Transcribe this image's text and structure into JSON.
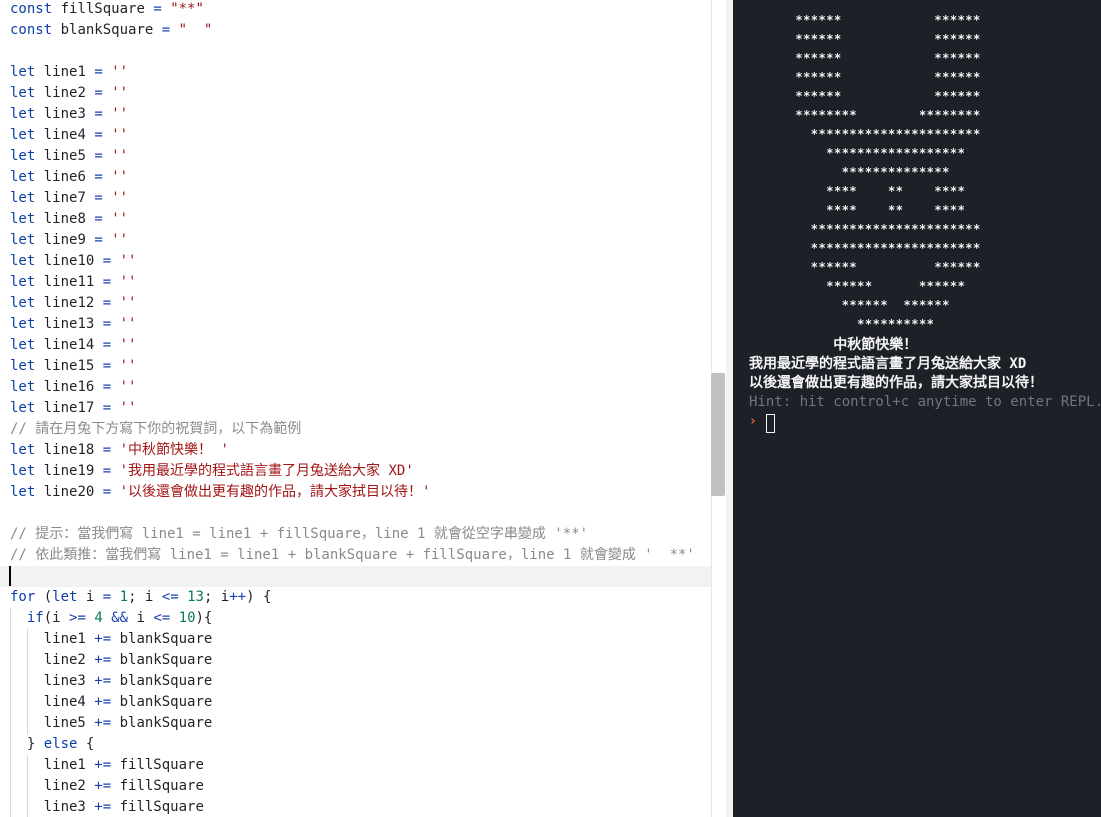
{
  "editor": {
    "lines": [
      [
        [
          "kw",
          "const"
        ],
        [
          "id",
          " fillSquare "
        ],
        [
          "op",
          "="
        ],
        [
          "id",
          " "
        ],
        [
          "str",
          "\"**\""
        ]
      ],
      [
        [
          "kw",
          "const"
        ],
        [
          "id",
          " blankSquare "
        ],
        [
          "op",
          "="
        ],
        [
          "id",
          " "
        ],
        [
          "str",
          "\"  \""
        ]
      ],
      [],
      [
        [
          "kw",
          "let"
        ],
        [
          "id",
          " line1 "
        ],
        [
          "op",
          "="
        ],
        [
          "id",
          " "
        ],
        [
          "str",
          "''"
        ]
      ],
      [
        [
          "kw",
          "let"
        ],
        [
          "id",
          " line2 "
        ],
        [
          "op",
          "="
        ],
        [
          "id",
          " "
        ],
        [
          "str",
          "''"
        ]
      ],
      [
        [
          "kw",
          "let"
        ],
        [
          "id",
          " line3 "
        ],
        [
          "op",
          "="
        ],
        [
          "id",
          " "
        ],
        [
          "str",
          "''"
        ]
      ],
      [
        [
          "kw",
          "let"
        ],
        [
          "id",
          " line4 "
        ],
        [
          "op",
          "="
        ],
        [
          "id",
          " "
        ],
        [
          "str",
          "''"
        ]
      ],
      [
        [
          "kw",
          "let"
        ],
        [
          "id",
          " line5 "
        ],
        [
          "op",
          "="
        ],
        [
          "id",
          " "
        ],
        [
          "str",
          "''"
        ]
      ],
      [
        [
          "kw",
          "let"
        ],
        [
          "id",
          " line6 "
        ],
        [
          "op",
          "="
        ],
        [
          "id",
          " "
        ],
        [
          "str",
          "''"
        ]
      ],
      [
        [
          "kw",
          "let"
        ],
        [
          "id",
          " line7 "
        ],
        [
          "op",
          "="
        ],
        [
          "id",
          " "
        ],
        [
          "str",
          "''"
        ]
      ],
      [
        [
          "kw",
          "let"
        ],
        [
          "id",
          " line8 "
        ],
        [
          "op",
          "="
        ],
        [
          "id",
          " "
        ],
        [
          "str",
          "''"
        ]
      ],
      [
        [
          "kw",
          "let"
        ],
        [
          "id",
          " line9 "
        ],
        [
          "op",
          "="
        ],
        [
          "id",
          " "
        ],
        [
          "str",
          "''"
        ]
      ],
      [
        [
          "kw",
          "let"
        ],
        [
          "id",
          " line10 "
        ],
        [
          "op",
          "="
        ],
        [
          "id",
          " "
        ],
        [
          "str",
          "''"
        ]
      ],
      [
        [
          "kw",
          "let"
        ],
        [
          "id",
          " line11 "
        ],
        [
          "op",
          "="
        ],
        [
          "id",
          " "
        ],
        [
          "str",
          "''"
        ]
      ],
      [
        [
          "kw",
          "let"
        ],
        [
          "id",
          " line12 "
        ],
        [
          "op",
          "="
        ],
        [
          "id",
          " "
        ],
        [
          "str",
          "''"
        ]
      ],
      [
        [
          "kw",
          "let"
        ],
        [
          "id",
          " line13 "
        ],
        [
          "op",
          "="
        ],
        [
          "id",
          " "
        ],
        [
          "str",
          "''"
        ]
      ],
      [
        [
          "kw",
          "let"
        ],
        [
          "id",
          " line14 "
        ],
        [
          "op",
          "="
        ],
        [
          "id",
          " "
        ],
        [
          "str",
          "''"
        ]
      ],
      [
        [
          "kw",
          "let"
        ],
        [
          "id",
          " line15 "
        ],
        [
          "op",
          "="
        ],
        [
          "id",
          " "
        ],
        [
          "str",
          "''"
        ]
      ],
      [
        [
          "kw",
          "let"
        ],
        [
          "id",
          " line16 "
        ],
        [
          "op",
          "="
        ],
        [
          "id",
          " "
        ],
        [
          "str",
          "''"
        ]
      ],
      [
        [
          "kw",
          "let"
        ],
        [
          "id",
          " line17 "
        ],
        [
          "op",
          "="
        ],
        [
          "id",
          " "
        ],
        [
          "str",
          "''"
        ]
      ],
      [
        [
          "cmt",
          "// 請在月兔下方寫下你的祝賀詞，以下為範例"
        ]
      ],
      [
        [
          "kw",
          "let"
        ],
        [
          "id",
          " line18 "
        ],
        [
          "op",
          "="
        ],
        [
          "id",
          " "
        ],
        [
          "str",
          "'中秋節快樂！ '"
        ]
      ],
      [
        [
          "kw",
          "let"
        ],
        [
          "id",
          " line19 "
        ],
        [
          "op",
          "="
        ],
        [
          "id",
          " "
        ],
        [
          "str",
          "'我用最近學的程式語言畫了月兔送給大家 XD'"
        ]
      ],
      [
        [
          "kw",
          "let"
        ],
        [
          "id",
          " line20 "
        ],
        [
          "op",
          "="
        ],
        [
          "id",
          " "
        ],
        [
          "str",
          "'以後還會做出更有趣的作品，請大家拭目以待！'"
        ]
      ],
      [],
      [
        [
          "cmt",
          "// 提示：當我們寫 line1 = line1 + fillSquare，line 1 就會從空字串變成 '**'"
        ]
      ],
      [
        [
          "cmt",
          "// 依此類推：當我們寫 line1 = line1 + blankSquare + fillSquare，line 1 就會變成 '  **'"
        ]
      ],
      [],
      [
        [
          "kw",
          "for"
        ],
        [
          "id",
          " ("
        ],
        [
          "kw",
          "let"
        ],
        [
          "id",
          " i "
        ],
        [
          "op",
          "="
        ],
        [
          "id",
          " "
        ],
        [
          "num",
          "1"
        ],
        [
          "id",
          "; i "
        ],
        [
          "op",
          "<="
        ],
        [
          "id",
          " "
        ],
        [
          "num",
          "13"
        ],
        [
          "id",
          "; i"
        ],
        [
          "op",
          "++"
        ],
        [
          "id",
          ") {"
        ]
      ],
      [
        [
          "id",
          "  "
        ],
        [
          "kw",
          "if"
        ],
        [
          "id",
          "(i "
        ],
        [
          "op",
          ">="
        ],
        [
          "id",
          " "
        ],
        [
          "num",
          "4"
        ],
        [
          "id",
          " "
        ],
        [
          "op",
          "&&"
        ],
        [
          "id",
          " i "
        ],
        [
          "op",
          "<="
        ],
        [
          "id",
          " "
        ],
        [
          "num",
          "10"
        ],
        [
          "id",
          "){"
        ]
      ],
      [
        [
          "id",
          "    line1 "
        ],
        [
          "op",
          "+="
        ],
        [
          "id",
          " blankSquare"
        ]
      ],
      [
        [
          "id",
          "    line2 "
        ],
        [
          "op",
          "+="
        ],
        [
          "id",
          " blankSquare"
        ]
      ],
      [
        [
          "id",
          "    line3 "
        ],
        [
          "op",
          "+="
        ],
        [
          "id",
          " blankSquare"
        ]
      ],
      [
        [
          "id",
          "    line4 "
        ],
        [
          "op",
          "+="
        ],
        [
          "id",
          " blankSquare"
        ]
      ],
      [
        [
          "id",
          "    line5 "
        ],
        [
          "op",
          "+="
        ],
        [
          "id",
          " blankSquare"
        ]
      ],
      [
        [
          "id",
          "  } "
        ],
        [
          "kw",
          "else"
        ],
        [
          "id",
          " {"
        ]
      ],
      [
        [
          "id",
          "    line1 "
        ],
        [
          "op",
          "+="
        ],
        [
          "id",
          " fillSquare"
        ]
      ],
      [
        [
          "id",
          "    line2 "
        ],
        [
          "op",
          "+="
        ],
        [
          "id",
          " fillSquare"
        ]
      ],
      [
        [
          "id",
          "    line3 "
        ],
        [
          "op",
          "+="
        ],
        [
          "id",
          " fillSquare"
        ]
      ]
    ]
  },
  "console": {
    "art": [
      "      ******            ******",
      "      ******            ******",
      "      ******            ******",
      "      ******            ******",
      "      ******            ******",
      "      ********        ********",
      "        **********************",
      "          ******************",
      "            **************",
      "          ****    **    ****",
      "          ****    **    ****",
      "        **********************",
      "        **********************",
      "        ******          ******",
      "          ******      ******",
      "            ******  ******",
      "              **********"
    ],
    "messages": [
      "          中秋節快樂！",
      "我用最近學的程式語言畫了月兔送給大家 XD",
      "以後還會做出更有趣的作品，請大家拭目以待！"
    ],
    "hint": "Hint: hit control+c anytime to enter REPL.",
    "prompt_symbol": "›"
  }
}
